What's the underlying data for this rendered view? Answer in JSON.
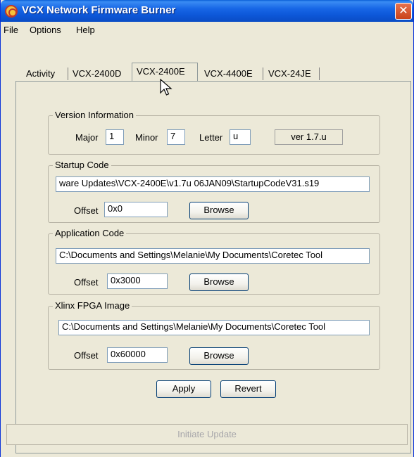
{
  "window": {
    "title": "VCX Network Firmware Burner",
    "close_glyph": "✕"
  },
  "menu": [
    "File",
    "Options",
    "Help"
  ],
  "tabs": [
    "Activity",
    "VCX-2400D",
    "VCX-2400E",
    "VCX-4400E",
    "VCX-24JE"
  ],
  "active_tab": "VCX-2400E",
  "version_info": {
    "legend": "Version Information",
    "major_label": "Major",
    "major_value": "1",
    "minor_label": "Minor",
    "minor_value": "7",
    "letter_label": "Letter",
    "letter_value": "u",
    "version_display": "ver 1.7.u"
  },
  "startup_code": {
    "legend": "Startup Code",
    "path": "ware Updates\\VCX-2400E\\v1.7u 06JAN09\\StartupCodeV31.s19",
    "offset_label": "Offset",
    "offset_value": "0x0",
    "browse_label": "Browse"
  },
  "application_code": {
    "legend": "Application Code",
    "path": "C:\\Documents and Settings\\Melanie\\My Documents\\Coretec Tool",
    "offset_label": "Offset",
    "offset_value": "0x3000",
    "browse_label": "Browse"
  },
  "fpga_image": {
    "legend": "Xlinx FPGA Image",
    "path": "C:\\Documents and Settings\\Melanie\\My Documents\\Coretec Tool",
    "offset_label": "Offset",
    "offset_value": "0x60000",
    "browse_label": "Browse"
  },
  "buttons": {
    "apply": "Apply",
    "revert": "Revert",
    "initiate": "Initiate Update"
  },
  "colors": {
    "titlebar": "#0d57d8",
    "face": "#ece9d8",
    "disabled_text": "#a7a6aa"
  }
}
